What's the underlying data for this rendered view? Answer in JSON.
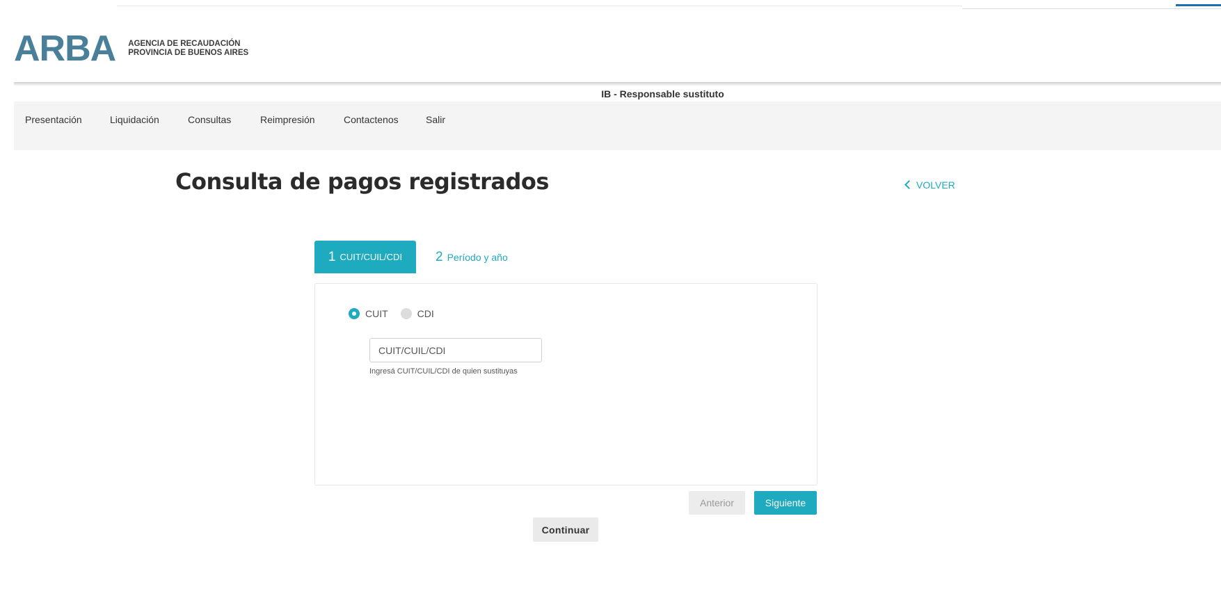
{
  "header": {
    "logo_text": "ARBA",
    "logo_sub_line1": "AGENCIA DE RECAUDACIÓN",
    "logo_sub_line2": "PROVINCIA DE BUENOS AIRES",
    "subtitle": "IB - Responsable sustituto"
  },
  "nav": {
    "items": [
      {
        "label": "Presentación"
      },
      {
        "label": "Liquidación"
      },
      {
        "label": "Consultas"
      },
      {
        "label": "Reimpresión"
      },
      {
        "label": "Contactenos"
      },
      {
        "label": "Salir"
      }
    ]
  },
  "main": {
    "title": "Consulta de pagos registrados",
    "back_label": "VOLVER",
    "steps": [
      {
        "number": "1",
        "label": "CUIT/CUIL/CDI",
        "active": true
      },
      {
        "number": "2",
        "label": "Período y año",
        "active": false
      }
    ],
    "form": {
      "radio_options": [
        {
          "label": "CUIT",
          "selected": true
        },
        {
          "label": "CDI",
          "selected": false
        }
      ],
      "input_value": "",
      "input_placeholder": "CUIT/CUIL/CDI",
      "help_text": "Ingresá CUIT/CUIL/CDI de quien sustituyas"
    },
    "buttons": {
      "previous": "Anterior",
      "next": "Siguiente",
      "continue": "Continuar"
    }
  },
  "colors": {
    "accent": "#1eaabf",
    "logo": "#4a7f9a",
    "nav_bg": "#f4f4f4"
  },
  "icons": {
    "back": "chevron-left-icon"
  }
}
